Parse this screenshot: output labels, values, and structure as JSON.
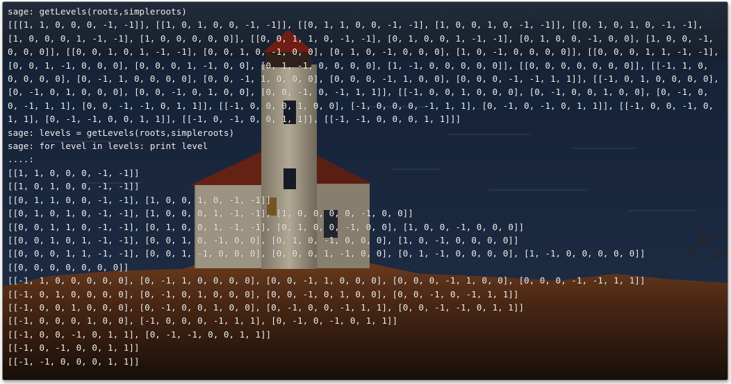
{
  "terminal": {
    "lines": [
      "sage: getLevels(roots,simpleroots)",
      "[[[1, 1, 0, 0, 0, -1, -1]], [[1, 0, 1, 0, 0, -1, -1]], [[0, 1, 1, 0, 0, -1, -1], [1, 0, 0, 1, 0, -1, -1]], [[0, 1, 0, 1, 0, -1, -1], [1, 0, 0, 0, 1, -1, -1], [1, 0, 0, 0, 0, 0]], [[0, 0, 1, 1, 0, -1, -1], [0, 1, 0, 0, 1, -1, -1], [0, 1, 0, 0, -1, 0, 0], [1, 0, 0, -1, 0, 0, 0]], [[0, 0, 1, 0, 1, -1, -1], [0, 0, 1, 0, -1, 0, 0], [0, 1, 0, -1, 0, 0, 0], [1, 0, -1, 0, 0, 0, 0]], [[0, 0, 0, 1, 1, -1, -1], [0, 0, 1, -1, 0, 0, 0], [0, 0, 0, 1, -1, 0, 0], [0, 1, -1, 0, 0, 0, 0], [1, -1, 0, 0, 0, 0, 0]], [[0, 0, 0, 0, 0, 0, 0]], [[-1, 1, 0, 0, 0, 0, 0], [0, -1, 1, 0, 0, 0, 0], [0, 0, -1, 1, 0, 0, 0], [0, 0, 0, -1, 1, 0, 0], [0, 0, 0, -1, -1, 1, 1]], [[-1, 0, 1, 0, 0, 0, 0], [0, -1, 0, 1, 0, 0, 0], [0, 0, -1, 0, 1, 0, 0], [0, 0, -1, 0, -1, 1, 1]], [[-1, 0, 0, 1, 0, 0, 0], [0, -1, 0, 0, 1, 0, 0], [0, -1, 0, 0, -1, 1, 1], [0, 0, -1, -1, 0, 1, 1]], [[-1, 0, 0, 0, 1, 0, 0], [-1, 0, 0, 0, -1, 1, 1], [0, -1, 0, -1, 0, 1, 1]], [[-1, 0, 0, -1, 0, 1, 1], [0, -1, -1, 0, 0, 1, 1]], [[-1, 0, -1, 0, 0, 1, 1]], [[-1, -1, 0, 0, 0, 1, 1]]]",
      "sage: levels = getLevels(roots,simpleroots)",
      "sage: for level in levels: print level",
      "....:",
      "[[1, 1, 0, 0, 0, -1, -1]]",
      "[[1, 0, 1, 0, 0, -1, -1]]",
      "[[0, 1, 1, 0, 0, -1, -1], [1, 0, 0, 1, 0, -1, -1]]",
      "[[0, 1, 0, 1, 0, -1, -1], [1, 0, 0, 0, 1, -1, -1], [1, 0, 0, 0, 0, -1, 0, 0]]",
      "[[0, 0, 1, 1, 0, -1, -1], [0, 1, 0, 0, 1, -1, -1], [0, 1, 0, 0, -1, 0, 0], [1, 0, 0, -1, 0, 0, 0]]",
      "[[0, 0, 1, 0, 1, -1, -1], [0, 0, 1, 0, -1, 0, 0], [0, 1, 0, -1, 0, 0, 0], [1, 0, -1, 0, 0, 0, 0]]",
      "[[0, 0, 0, 1, 1, -1, -1], [0, 0, 1, -1, 0, 0, 0], [0, 0, 0, 1, -1, 0, 0], [0, 1, -1, 0, 0, 0, 0], [1, -1, 0, 0, 0, 0, 0]]",
      "[[0, 0, 0, 0, 0, 0, 0]]",
      "[[-1, 1, 0, 0, 0, 0, 0], [0, -1, 1, 0, 0, 0, 0], [0, 0, -1, 1, 0, 0, 0], [0, 0, 0, -1, 1, 0, 0], [0, 0, 0, -1, -1, 1, 1]]",
      "[[-1, 0, 1, 0, 0, 0, 0], [0, -1, 0, 1, 0, 0, 0], [0, 0, -1, 0, 1, 0, 0], [0, 0, -1, 0, -1, 1, 1]]",
      "[[-1, 0, 0, 1, 0, 0, 0], [0, -1, 0, 0, 1, 0, 0], [0, -1, 0, 0, -1, 1, 1], [0, 0, -1, -1, 0, 1, 1]]",
      "[[-1, 0, 0, 0, 1, 0, 0], [-1, 0, 0, 0, -1, 1, 1], [0, -1, 0, -1, 0, 1, 1]]",
      "[[-1, 0, 0, -1, 0, 1, 1], [0, -1, -1, 0, 0, 1, 1]]",
      "[[-1, 0, -1, 0, 0, 1, 1]]",
      "[[-1, -1, 0, 0, 0, 1, 1]]"
    ]
  },
  "colors": {
    "text": "#f2f2f2",
    "sky": "#1f2c40",
    "sea": "#152338",
    "cliff": "#7a4322"
  },
  "icons": {
    "background": "lighthouse-wallpaper"
  }
}
